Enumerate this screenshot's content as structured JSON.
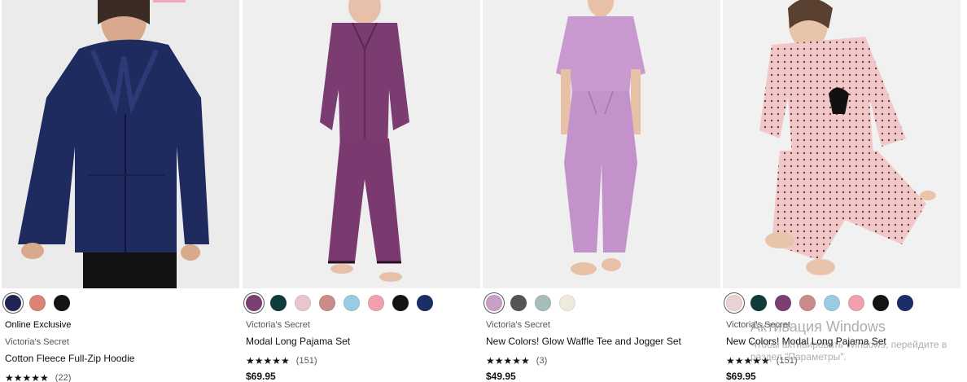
{
  "products": [
    {
      "badge": "Online Exclusive",
      "brand": "Victoria's Secret",
      "name": "Cotton Fleece Full-Zip Hoodie",
      "stars": "★★★★★",
      "review_count": "(22)",
      "rating": 4.5,
      "price": "",
      "swatches": [
        "#1f2551",
        "#d98474",
        "#141414"
      ],
      "selected_swatch": 0,
      "image": {
        "bg": "#ebebeb",
        "garment": "#1e2a5e",
        "skin": "#d9a98e",
        "alt": "navy hoodie"
      }
    },
    {
      "badge": "",
      "brand": "Victoria's Secret",
      "name": "Modal Long Pajama Set",
      "stars": "★★★★★",
      "review_count": "(151)",
      "rating": 4.5,
      "price": "$69.95",
      "swatches": [
        "#7a3f73",
        "#0f3b3b",
        "#e8c7cc",
        "#c98c8a",
        "#9bcbe3",
        "#f1a0b0",
        "#141414",
        "#1d2d66"
      ],
      "selected_swatch": 0,
      "image": {
        "bg": "#efefef",
        "garment": "#7b3c72",
        "skin": "#e6c0a8",
        "alt": "purple pajama set"
      }
    },
    {
      "badge": "",
      "brand": "Victoria's Secret",
      "name": "New Colors! Glow Waffle Tee and Jogger Set",
      "stars": "★★★★★",
      "review_count": "(3)",
      "rating": 5,
      "price": "$49.95",
      "swatches": [
        "#c8a0c6",
        "#555555",
        "#a6bdbb",
        "#efeadd"
      ],
      "selected_swatch": 0,
      "image": {
        "bg": "#efefef",
        "garment": "#c99ad0",
        "skin": "#e8c0a6",
        "alt": "lilac waffle set"
      }
    },
    {
      "badge": "",
      "brand": "Victoria's Secret",
      "name": "New Colors! Modal Long Pajama Set",
      "stars": "★★★★★",
      "review_count": "(151)",
      "rating": 4.5,
      "price": "$69.95",
      "swatches": [
        "#ead2d2",
        "#0f3b3b",
        "#7a3f73",
        "#c98c8a",
        "#9bcbe3",
        "#f1a0b0",
        "#141414",
        "#1d2d66"
      ],
      "selected_swatch": 0,
      "image": {
        "bg": "#f1f1f1",
        "garment": "#f0c8c8",
        "skin": "#e8c4ab",
        "alt": "pink dotted pajama set"
      }
    }
  ],
  "watermark": {
    "title": "Активация Windows",
    "subtitle": "Чтобы активировать Windows, перейдите в раздел \"Параметры\"."
  }
}
